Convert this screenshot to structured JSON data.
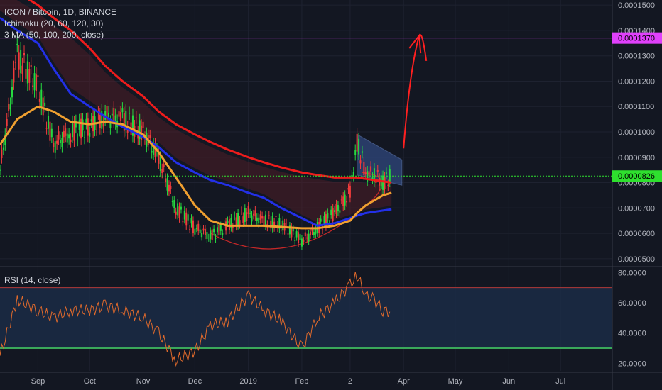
{
  "header": {
    "title": "ICON / Bitcoin, 1D, BINANCE",
    "indicator1": "Ichimoku (20, 60, 120, 30)",
    "indicator2": "3 MA (50, 100, 200, close)"
  },
  "rsi_panel": {
    "title": "RSI (14, close)",
    "ticks": [
      "80.0000",
      "60.0000",
      "40.0000",
      "20.0000"
    ],
    "tick_values": [
      80,
      60,
      40,
      20
    ],
    "upper_band": 70,
    "lower_band": 30
  },
  "price_axis": {
    "ticks": [
      "0.0001500",
      "0.0001400",
      "0.0001300",
      "0.0001200",
      "0.0001100",
      "0.0001000",
      "0.0000900",
      "0.0000800",
      "0.0000700",
      "0.0000600",
      "0.0000500"
    ],
    "tick_values": [
      0.00015,
      0.00014,
      0.00013,
      0.00012,
      0.00011,
      0.0001,
      9e-05,
      8e-05,
      7e-05,
      6e-05,
      5e-05
    ],
    "resistance_label": "0.0001370",
    "resistance_value": 0.000137,
    "current_label": "0.0000826",
    "current_value": 8.26e-05
  },
  "time_axis": {
    "labels": [
      "Sep",
      "Oct",
      "Nov",
      "Dec",
      "2019",
      "Feb",
      "2",
      "Apr",
      "May",
      "Jun",
      "Jul"
    ]
  },
  "colors": {
    "background": "#131722",
    "grid": "#1e2230",
    "up": "#26d940",
    "down": "#ef3b3b",
    "ma50": "#f0a030",
    "ma100": "#2330e8",
    "ma200": "#ee1c1c",
    "resistance": "#e040fb",
    "current": "#2ee02e",
    "rsi_line": "#e06a2c",
    "rsi_band": "#1b2d48",
    "cloud_red": "#5a1f28",
    "annotation_red": "#ff2020",
    "annotation_blue": "#3a5a9e"
  },
  "chart_data": {
    "type": "candlestick",
    "x": [
      "2018-08-10",
      "2018-08-20",
      "2018-09-01",
      "2018-09-10",
      "2018-09-20",
      "2018-10-01",
      "2018-10-10",
      "2018-10-20",
      "2018-11-01",
      "2018-11-10",
      "2018-11-20",
      "2018-12-01",
      "2018-12-10",
      "2018-12-20",
      "2019-01-01",
      "2019-01-10",
      "2019-01-20",
      "2019-02-01",
      "2019-02-10",
      "2019-02-20",
      "2019-03-01",
      "2019-03-05",
      "2019-03-10",
      "2019-03-15",
      "2019-03-20",
      "2019-03-25"
    ],
    "close": [
      8.5e-05,
      0.00013,
      0.000118,
      9.5e-05,
      0.0001,
      0.000102,
      0.000106,
      0.000105,
      0.0001,
      9e-05,
      7e-05,
      6.2e-05,
      5.9e-05,
      6.3e-05,
      6.8e-05,
      6.5e-05,
      6.4e-05,
      5.7e-05,
      6.2e-05,
      6.8e-05,
      7.6e-05,
      9.6e-05,
      8.4e-05,
      8.3e-05,
      8e-05,
      8.26e-05
    ],
    "ma50": [
      9.5e-05,
      0.000105,
      0.00011,
      0.000108,
      0.000104,
      0.000103,
      0.000104,
      0.000103,
      9.9e-05,
      9.2e-05,
      8.2e-05,
      7.1e-05,
      6.5e-05,
      6.3e-05,
      6.3e-05,
      6.3e-05,
      6.25e-05,
      6.2e-05,
      6.2e-05,
      6.3e-05,
      6.5e-05,
      6.8e-05,
      7.1e-05,
      7.3e-05,
      7.5e-05,
      7.6e-05
    ],
    "ma100": [
      0.000145,
      0.00014,
      0.000135,
      0.000125,
      0.000115,
      0.00011,
      0.000106,
      0.000102,
      9.8e-05,
      9.4e-05,
      8.8e-05,
      8.4e-05,
      8.1e-05,
      7.9e-05,
      7.6e-05,
      7.4e-05,
      7e-05,
      6.6e-05,
      6.3e-05,
      6.4e-05,
      6.6e-05,
      6.7e-05,
      6.8e-05,
      6.85e-05,
      6.9e-05,
      6.95e-05
    ],
    "ma200": [
      0.00016,
      0.000155,
      0.00015,
      0.000145,
      0.00014,
      0.000133,
      0.000126,
      0.00012,
      0.000114,
      0.000108,
      0.000103,
      9.9e-05,
      9.6e-05,
      9.3e-05,
      9e-05,
      8.8e-05,
      8.6e-05,
      8.4e-05,
      8.3e-05,
      8.2e-05,
      8.2e-05,
      8.2e-05,
      8.15e-05,
      8.1e-05,
      8.05e-05,
      8e-05
    ],
    "rsi": [
      25,
      62,
      55,
      50,
      55,
      55,
      58,
      55,
      50,
      40,
      22,
      28,
      45,
      48,
      65,
      55,
      48,
      30,
      50,
      60,
      72,
      78,
      65,
      62,
      55,
      54
    ],
    "resistance": 0.000137,
    "current": 8.26e-05,
    "xlim": [
      "2018-08-10",
      "2019-07-31"
    ],
    "ylim": [
      4.8e-05,
      0.000152
    ],
    "rsi_ylim": [
      15,
      82
    ]
  }
}
